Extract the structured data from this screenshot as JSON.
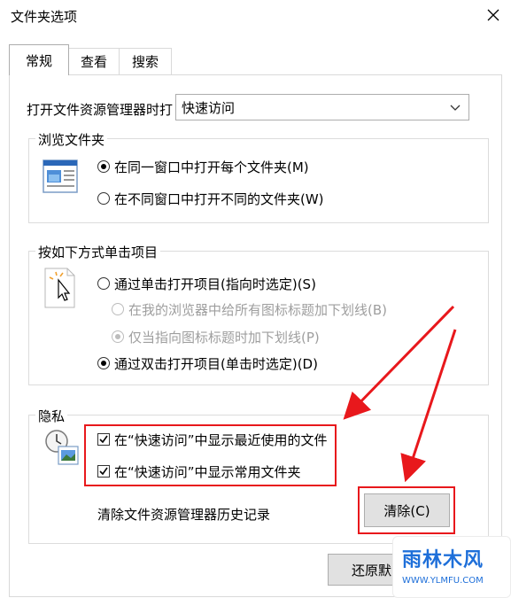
{
  "window": {
    "title": "文件夹选项"
  },
  "tabs": [
    {
      "label": "常规",
      "active": true
    },
    {
      "label": "查看",
      "active": false
    },
    {
      "label": "搜索",
      "active": false
    }
  ],
  "open_explorer": {
    "label": "打开文件资源管理器时打",
    "selected": "快速访问"
  },
  "browse_folders": {
    "legend": "浏览文件夹",
    "options": [
      {
        "label": "在同一窗口中打开每个文件夹(M)",
        "checked": true
      },
      {
        "label": "在不同窗口中打开不同的文件夹(W)",
        "checked": false
      }
    ]
  },
  "click_items": {
    "legend": "按如下方式单击项目",
    "single": "通过单击打开项目(指向时选定)(S)",
    "underline_all": "在我的浏览器中给所有图标标题加下划线(B)",
    "underline_hover": "仅当指向图标标题时加下划线(P)",
    "double": "通过双击打开项目(单击时选定)(D)"
  },
  "privacy": {
    "legend": "隐私",
    "recent_files": "在“快速访问”中显示最近使用的文件",
    "frequent_folders": "在“快速访问”中显示常用文件夹",
    "clear_label": "清除文件资源管理器历史记录",
    "clear_button": "清除(C)"
  },
  "restore_button": "还原默",
  "watermark": {
    "logo": "雨林木风",
    "url": "WWW.YLMFU.COM"
  },
  "colors": {
    "annotation": "#e8181c",
    "accent_blue": "#1e6fd9"
  }
}
